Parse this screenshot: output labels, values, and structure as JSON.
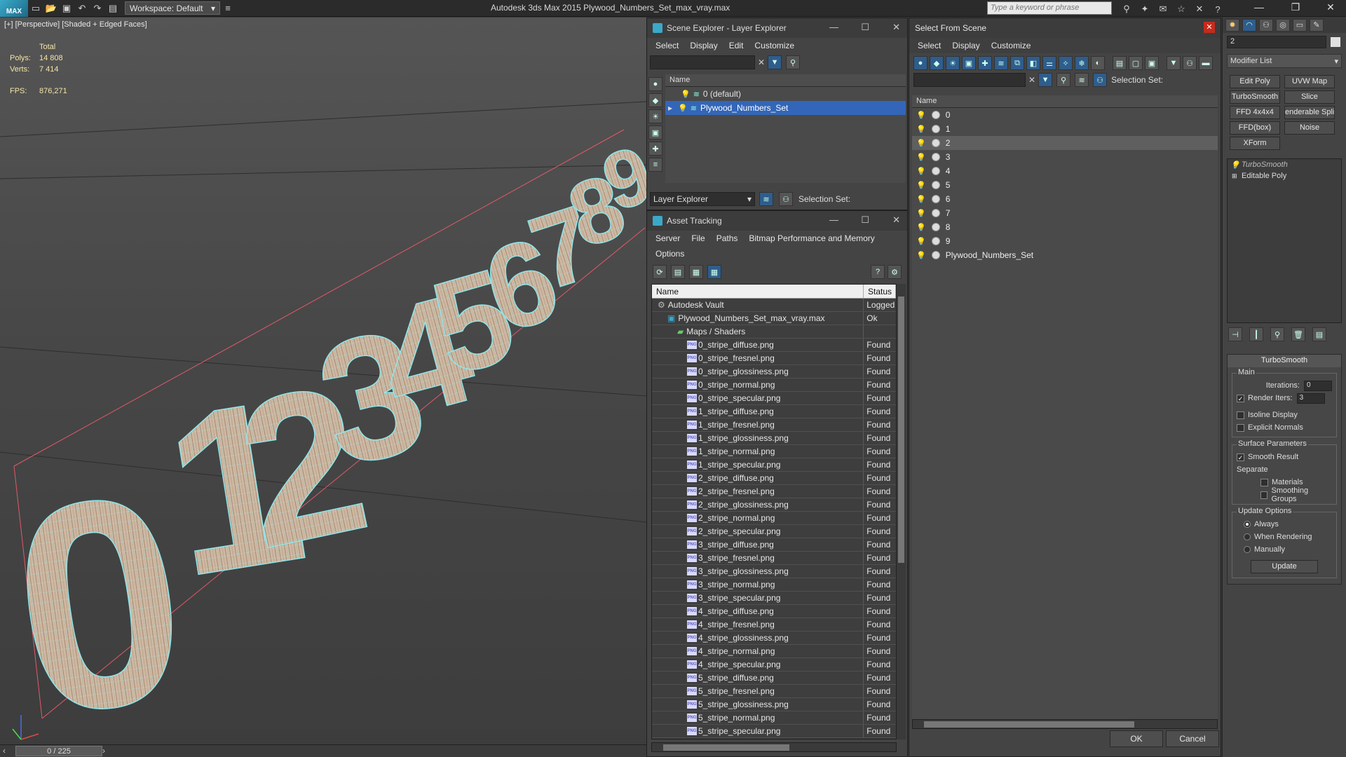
{
  "titlebar": {
    "logo": "MAX",
    "workspace": "Workspace: Default",
    "title": "Autodesk 3ds Max  2015     Plywood_Numbers_Set_max_vray.max",
    "search_placeholder": "Type a keyword or phrase"
  },
  "viewport": {
    "label": "[+] [Perspective] [Shaded + Edged Faces]",
    "stats": {
      "total_label": "Total",
      "polys_label": "Polys:",
      "polys": "14 808",
      "verts_label": "Verts:",
      "verts": "7 414",
      "fps_label": "FPS:",
      "fps": "876,271"
    },
    "digits": [
      "0",
      "1",
      "2",
      "3",
      "4",
      "5",
      "6",
      "7",
      "8",
      "9"
    ]
  },
  "timeslider": {
    "frame": "0 / 225"
  },
  "scene_explorer": {
    "title": "Scene Explorer - Layer Explorer",
    "menu": [
      "Select",
      "Display",
      "Edit",
      "Customize"
    ],
    "column": "Name",
    "layers": [
      {
        "name": "0 (default)",
        "selected": false
      },
      {
        "name": "Plywood_Numbers_Set",
        "selected": true
      }
    ],
    "footer_dropdown": "Layer Explorer",
    "selection_set": "Selection Set:"
  },
  "asset_tracking": {
    "title": "Asset Tracking",
    "menu": [
      "Server",
      "File",
      "Paths",
      "Bitmap Performance and Memory"
    ],
    "menu2": "Options",
    "col_name": "Name",
    "col_status": "Status",
    "rows": [
      {
        "name": "Autodesk Vault",
        "status": "Logged",
        "indent": 1,
        "type": "vault"
      },
      {
        "name": "Plywood_Numbers_Set_max_vray.max",
        "status": "Ok",
        "indent": 2,
        "type": "max"
      },
      {
        "name": "Maps / Shaders",
        "status": "",
        "indent": 3,
        "type": "folder"
      },
      {
        "name": "0_stripe_diffuse.png",
        "status": "Found",
        "indent": 4,
        "type": "png"
      },
      {
        "name": "0_stripe_fresnel.png",
        "status": "Found",
        "indent": 4,
        "type": "png"
      },
      {
        "name": "0_stripe_glossiness.png",
        "status": "Found",
        "indent": 4,
        "type": "png"
      },
      {
        "name": "0_stripe_normal.png",
        "status": "Found",
        "indent": 4,
        "type": "png"
      },
      {
        "name": "0_stripe_specular.png",
        "status": "Found",
        "indent": 4,
        "type": "png"
      },
      {
        "name": "1_stripe_diffuse.png",
        "status": "Found",
        "indent": 4,
        "type": "png"
      },
      {
        "name": "1_stripe_fresnel.png",
        "status": "Found",
        "indent": 4,
        "type": "png"
      },
      {
        "name": "1_stripe_glossiness.png",
        "status": "Found",
        "indent": 4,
        "type": "png"
      },
      {
        "name": "1_stripe_normal.png",
        "status": "Found",
        "indent": 4,
        "type": "png"
      },
      {
        "name": "1_stripe_specular.png",
        "status": "Found",
        "indent": 4,
        "type": "png"
      },
      {
        "name": "2_stripe_diffuse.png",
        "status": "Found",
        "indent": 4,
        "type": "png"
      },
      {
        "name": "2_stripe_fresnel.png",
        "status": "Found",
        "indent": 4,
        "type": "png"
      },
      {
        "name": "2_stripe_glossiness.png",
        "status": "Found",
        "indent": 4,
        "type": "png"
      },
      {
        "name": "2_stripe_normal.png",
        "status": "Found",
        "indent": 4,
        "type": "png"
      },
      {
        "name": "2_stripe_specular.png",
        "status": "Found",
        "indent": 4,
        "type": "png"
      },
      {
        "name": "3_stripe_diffuse.png",
        "status": "Found",
        "indent": 4,
        "type": "png"
      },
      {
        "name": "3_stripe_fresnel.png",
        "status": "Found",
        "indent": 4,
        "type": "png"
      },
      {
        "name": "3_stripe_glossiness.png",
        "status": "Found",
        "indent": 4,
        "type": "png"
      },
      {
        "name": "3_stripe_normal.png",
        "status": "Found",
        "indent": 4,
        "type": "png"
      },
      {
        "name": "3_stripe_specular.png",
        "status": "Found",
        "indent": 4,
        "type": "png"
      },
      {
        "name": "4_stripe_diffuse.png",
        "status": "Found",
        "indent": 4,
        "type": "png"
      },
      {
        "name": "4_stripe_fresnel.png",
        "status": "Found",
        "indent": 4,
        "type": "png"
      },
      {
        "name": "4_stripe_glossiness.png",
        "status": "Found",
        "indent": 4,
        "type": "png"
      },
      {
        "name": "4_stripe_normal.png",
        "status": "Found",
        "indent": 4,
        "type": "png"
      },
      {
        "name": "4_stripe_specular.png",
        "status": "Found",
        "indent": 4,
        "type": "png"
      },
      {
        "name": "5_stripe_diffuse.png",
        "status": "Found",
        "indent": 4,
        "type": "png"
      },
      {
        "name": "5_stripe_fresnel.png",
        "status": "Found",
        "indent": 4,
        "type": "png"
      },
      {
        "name": "5_stripe_glossiness.png",
        "status": "Found",
        "indent": 4,
        "type": "png"
      },
      {
        "name": "5_stripe_normal.png",
        "status": "Found",
        "indent": 4,
        "type": "png"
      },
      {
        "name": "5_stripe_specular.png",
        "status": "Found",
        "indent": 4,
        "type": "png"
      }
    ]
  },
  "select_from_scene": {
    "title": "Select From Scene",
    "menu": [
      "Select",
      "Display",
      "Customize"
    ],
    "selection_set": "Selection Set:",
    "column": "Name",
    "objects": [
      {
        "name": "0",
        "selected": false
      },
      {
        "name": "1",
        "selected": false
      },
      {
        "name": "2",
        "selected": true
      },
      {
        "name": "3",
        "selected": false
      },
      {
        "name": "4",
        "selected": false
      },
      {
        "name": "5",
        "selected": false
      },
      {
        "name": "6",
        "selected": false
      },
      {
        "name": "7",
        "selected": false
      },
      {
        "name": "8",
        "selected": false
      },
      {
        "name": "9",
        "selected": false
      },
      {
        "name": "Plywood_Numbers_Set",
        "selected": false
      }
    ],
    "ok": "OK",
    "cancel": "Cancel"
  },
  "command_panel": {
    "object_name": "2",
    "modifier_list": "Modifier List",
    "modifier_buttons": [
      "Edit Poly",
      "UVW Map",
      "TurboSmooth",
      "Slice",
      "FFD 4x4x4",
      "enderable Splin",
      "FFD(box)",
      "Noise",
      "XForm"
    ],
    "stack": [
      "TurboSmooth",
      "Editable Poly"
    ],
    "rollout_title": "TurboSmooth",
    "main_label": "Main",
    "iterations_label": "Iterations:",
    "iterations": "0",
    "render_iters_label": "Render Iters:",
    "render_iters": "3",
    "isoline": "Isoline Display",
    "explicit_normals": "Explicit Normals",
    "surface_params": "Surface Parameters",
    "smooth_result": "Smooth Result",
    "separate": "Separate",
    "materials": "Materials",
    "smoothing_groups": "Smoothing Groups",
    "update_options": "Update Options",
    "always": "Always",
    "when_rendering": "When Rendering",
    "manually": "Manually",
    "update": "Update"
  }
}
